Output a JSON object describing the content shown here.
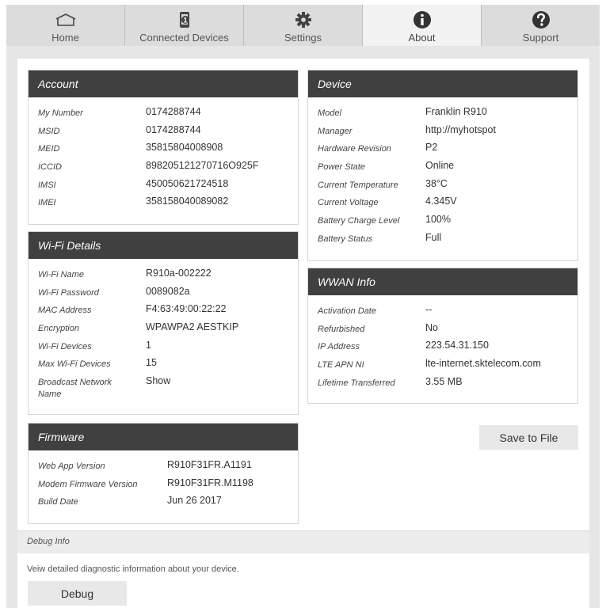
{
  "tabs": [
    {
      "label": "Home",
      "icon": "home-icon"
    },
    {
      "label": "Connected Devices",
      "icon": "connected-devices-icon",
      "badge": "1"
    },
    {
      "label": "Settings",
      "icon": "gear-icon"
    },
    {
      "label": "About",
      "icon": "info-icon",
      "active": true
    },
    {
      "label": "Support",
      "icon": "help-icon"
    }
  ],
  "account": {
    "title": "Account",
    "rows": [
      {
        "label": "My Number",
        "value": "0174288744"
      },
      {
        "label": "MSID",
        "value": "0174288744"
      },
      {
        "label": "MEID",
        "value": "35815804008908"
      },
      {
        "label": "ICCID",
        "value": "898205121270716O925F"
      },
      {
        "label": "IMSI",
        "value": "450050621724518"
      },
      {
        "label": "IMEI",
        "value": "358158040089082"
      }
    ]
  },
  "wifi": {
    "title": "Wi-Fi Details",
    "rows": [
      {
        "label": "Wi-Fi Name",
        "value": "R910a-002222"
      },
      {
        "label": "Wi-Fi Password",
        "value": "0089082a"
      },
      {
        "label": "MAC Address",
        "value": "F4:63:49:00:22:22"
      },
      {
        "label": "Encryption",
        "value": "WPAWPA2 AESTKIP"
      },
      {
        "label": "Wi-Fi Devices",
        "value": "1"
      },
      {
        "label": "Max Wi-Fi Devices",
        "value": "15"
      },
      {
        "label": "Broadcast Network Name",
        "value": "Show"
      }
    ]
  },
  "firmware": {
    "title": "Firmware",
    "rows": [
      {
        "label": "Web App Version",
        "value": "R910F31FR.A1191"
      },
      {
        "label": "Modem Firmware Version",
        "value": "R910F31FR.M1198"
      },
      {
        "label": "Build Date",
        "value": "Jun 26 2017"
      }
    ]
  },
  "device": {
    "title": "Device",
    "rows": [
      {
        "label": "Model",
        "value": "Franklin R910"
      },
      {
        "label": "Manager",
        "value": "http://myhotspot"
      },
      {
        "label": "Hardware Revision",
        "value": "P2"
      },
      {
        "label": "Power State",
        "value": "Online"
      },
      {
        "label": "Current Temperature",
        "value": "38°C"
      },
      {
        "label": "Current Voltage",
        "value": "4.345V"
      },
      {
        "label": "Battery Charge Level",
        "value": "100%"
      },
      {
        "label": "Battery Status",
        "value": "Full"
      }
    ]
  },
  "wwan": {
    "title": "WWAN Info",
    "rows": [
      {
        "label": "Activation Date",
        "value": "--"
      },
      {
        "label": "Refurbished",
        "value": "No"
      },
      {
        "label": "IP Address",
        "value": "223.54.31.150"
      },
      {
        "label": "LTE APN NI",
        "value": "lte-internet.sktelecom.com"
      },
      {
        "label": "Lifetime Transferred",
        "value": "3.55 MB"
      }
    ]
  },
  "save_button": "Save to File",
  "debug": {
    "title": "Debug Info",
    "description": "Veiw detailed diagnostic information about your device.",
    "button": "Debug"
  },
  "colors": {
    "header_bg": "#404040",
    "tab_bg": "#dcdcdc",
    "active_tab_bg": "#f2f2f2"
  }
}
